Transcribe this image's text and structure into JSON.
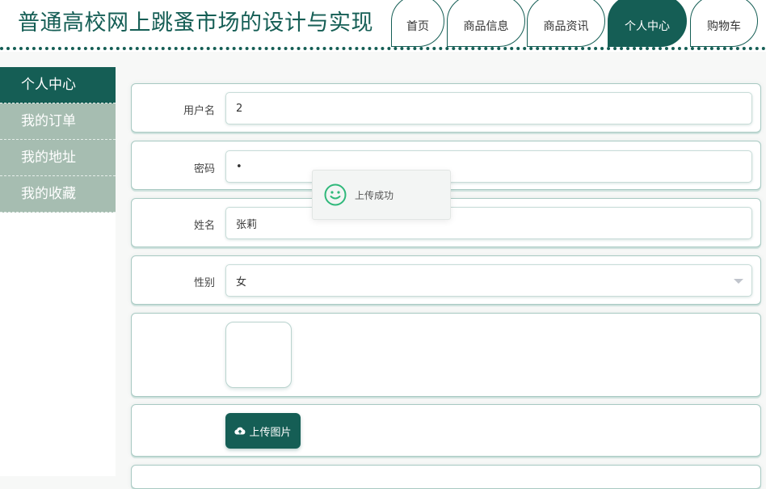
{
  "header": {
    "title": "普通高校网上跳蚤市场的设计与实现",
    "nav": [
      {
        "label": "首页",
        "active": false
      },
      {
        "label": "商品信息",
        "active": false
      },
      {
        "label": "商品资讯",
        "active": false
      },
      {
        "label": "个人中心",
        "active": true
      },
      {
        "label": "购物车",
        "active": false
      }
    ]
  },
  "sidebar": {
    "items": [
      {
        "label": "个人中心",
        "active": true
      },
      {
        "label": "我的订单",
        "active": false
      },
      {
        "label": "我的地址",
        "active": false
      },
      {
        "label": "我的收藏",
        "active": false
      }
    ]
  },
  "form": {
    "username_label": "用户名",
    "username_value": "2",
    "password_label": "密码",
    "password_value": "•",
    "name_label": "姓名",
    "name_value": "张莉",
    "gender_label": "性别",
    "gender_value": "女",
    "upload_label": "上传图片"
  },
  "toast": {
    "message": "上传成功"
  },
  "colors": {
    "primary": "#155e55",
    "sidebar_inactive": "#a6bdb1",
    "toast_icon": "#2fb87a"
  }
}
